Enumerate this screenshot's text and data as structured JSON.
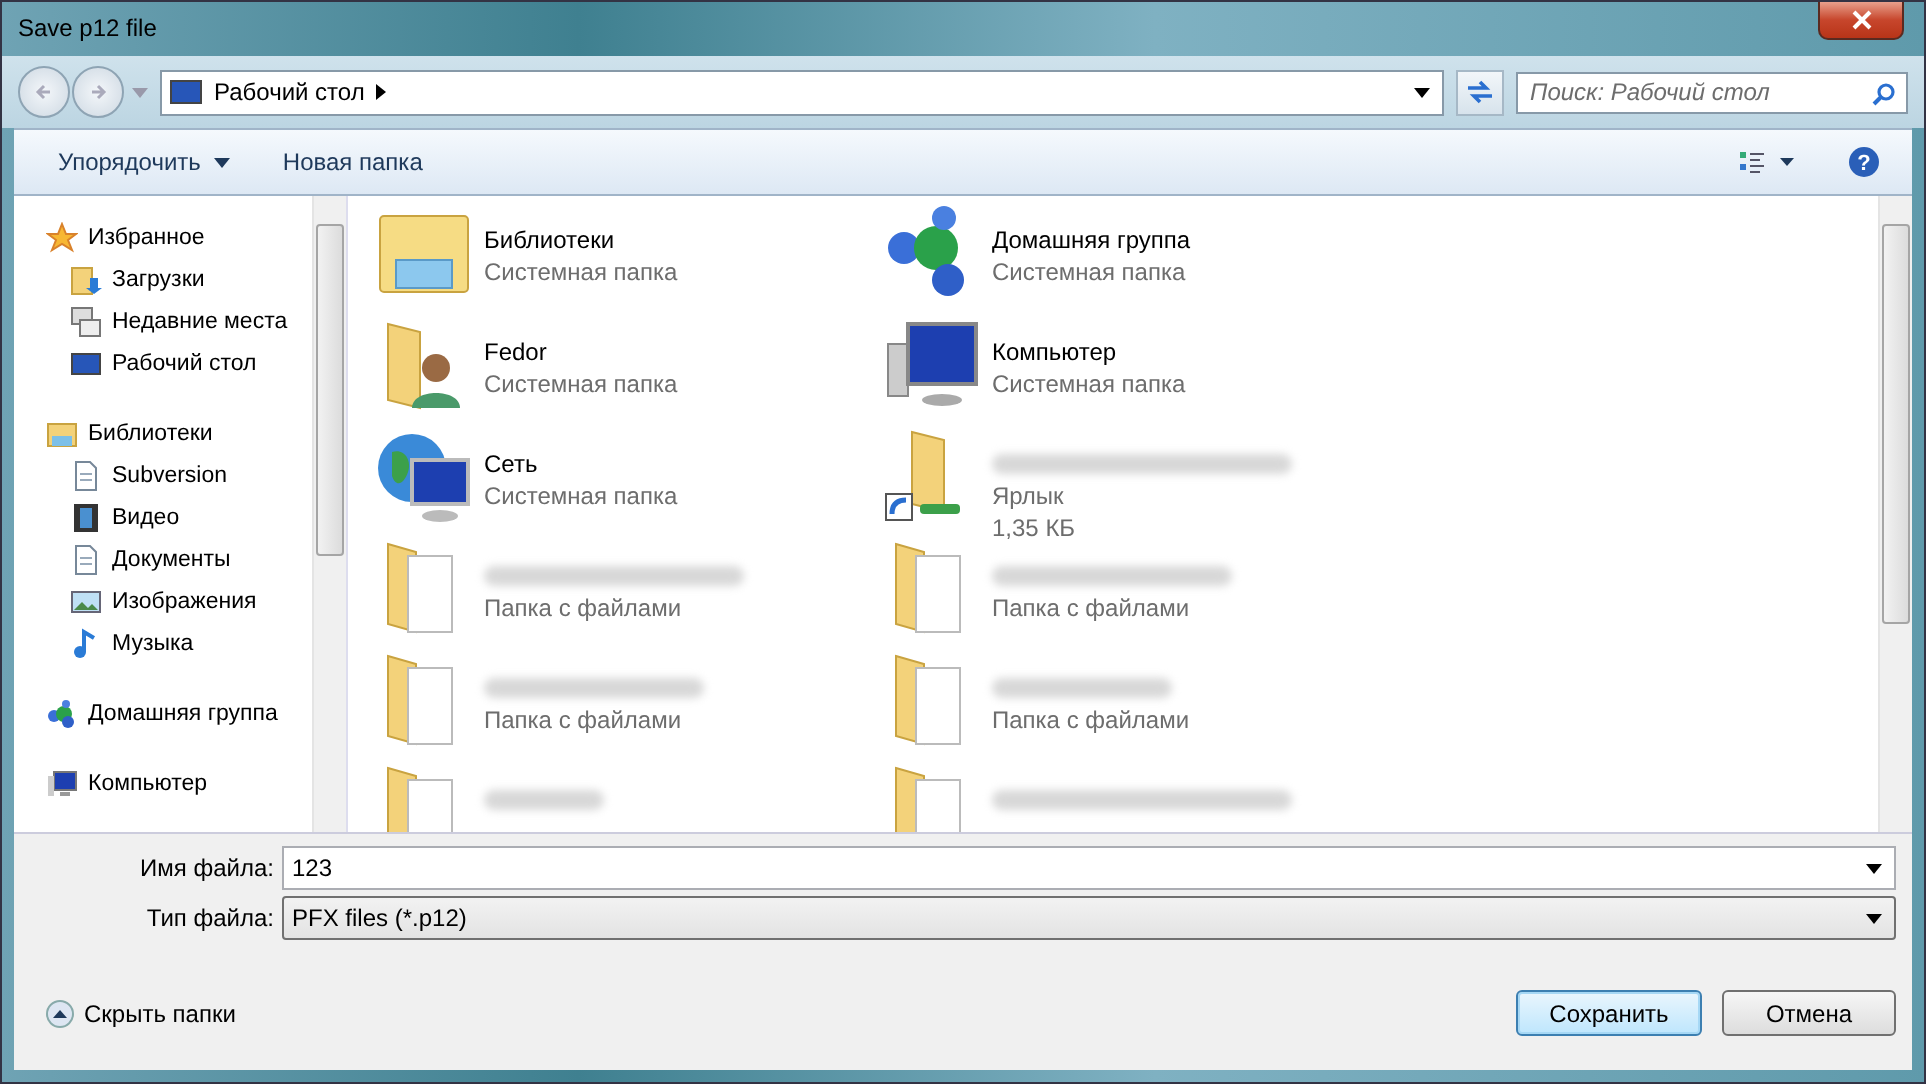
{
  "window": {
    "title": "Save p12 file"
  },
  "address_bar": {
    "path": "Рабочий стол"
  },
  "search": {
    "placeholder": "Поиск: Рабочий стол"
  },
  "toolbar": {
    "buttons": [
      {
        "label": "Упорядочить",
        "kind": "menu"
      },
      {
        "label": "Новая папка",
        "kind": "plain"
      }
    ],
    "help": {
      "label": "?"
    }
  },
  "sidebar": {
    "groups": [
      {
        "label": "Избранное",
        "children": [
          {
            "label": "Загрузки"
          },
          {
            "label": "Недавние места"
          },
          {
            "label": "Рабочий стол"
          }
        ]
      },
      {
        "label": "Библиотеки",
        "children": [
          {
            "label": "Subversion"
          },
          {
            "label": "Видео"
          },
          {
            "label": "Документы"
          },
          {
            "label": "Изображения"
          },
          {
            "label": "Музыка"
          }
        ]
      },
      {
        "label": "Домашняя группа"
      },
      {
        "label": "Компьютер"
      }
    ]
  },
  "items": [
    {
      "name": "Библиотеки",
      "name_hidden": false,
      "details": [
        "Системная папка"
      ]
    },
    {
      "name": "Домашняя группа",
      "name_hidden": false,
      "details": [
        "Системная папка"
      ]
    },
    {
      "name": "Fedor",
      "name_hidden": false,
      "details": [
        "Системная папка"
      ]
    },
    {
      "name": "Компьютер",
      "name_hidden": false,
      "details": [
        "Системная папка"
      ]
    },
    {
      "name": "Сеть",
      "name_hidden": false,
      "details": [
        "Системная папка"
      ]
    },
    {
      "name_hidden": true,
      "details": [
        "Ярлык",
        "1,35 КБ"
      ]
    },
    {
      "name_hidden": true,
      "details": [
        "Папка с файлами"
      ]
    },
    {
      "name_hidden": true,
      "details": [
        "Папка с файлами"
      ]
    },
    {
      "name_hidden": true,
      "details": [
        "Папка с файлами"
      ]
    },
    {
      "name_hidden": true,
      "details": [
        "Папка с файлами"
      ]
    },
    {
      "name_hidden": true
    },
    {
      "name_hidden": true
    }
  ],
  "file_name": {
    "label": "Имя файла:",
    "value": "123"
  },
  "file_type": {
    "label": "Тип файла:",
    "value": "PFX files (*.p12)"
  },
  "hide_folders": {
    "label": "Скрыть папки"
  },
  "buttons": [
    {
      "label": "Сохранить",
      "default": true
    },
    {
      "label": "Отмена",
      "default": false
    }
  ]
}
